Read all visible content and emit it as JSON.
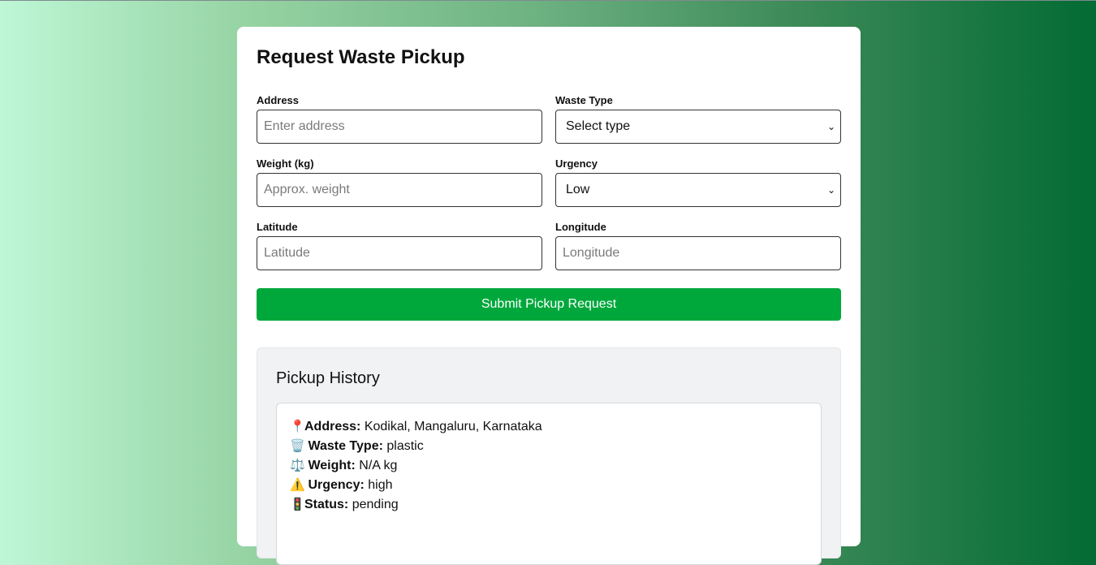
{
  "form": {
    "title": "Request Waste Pickup",
    "address": {
      "label": "Address",
      "placeholder": "Enter address"
    },
    "waste_type": {
      "label": "Waste Type",
      "value": "Select type"
    },
    "weight": {
      "label": "Weight (kg)",
      "placeholder": "Approx. weight"
    },
    "urgency": {
      "label": "Urgency",
      "value": "Low"
    },
    "latitude": {
      "label": "Latitude",
      "placeholder": "Latitude"
    },
    "longitude": {
      "label": "Longitude",
      "placeholder": "Longitude"
    },
    "submit_label": "Submit Pickup Request"
  },
  "history": {
    "title": "Pickup History",
    "entries": [
      {
        "address_label": "Address:",
        "address": "Kodikal, Mangaluru, Karnataka",
        "waste_type_label": "Waste Type:",
        "waste_type": "plastic",
        "weight_label": "Weight:",
        "weight": "N/A kg",
        "urgency_label": "Urgency:",
        "urgency": "high",
        "status_label": "Status:",
        "status": "pending"
      }
    ]
  },
  "icons": {
    "address": "pin-icon",
    "waste_type": "trash-can-icon",
    "weight": "scale-icon",
    "urgency": "warning-icon",
    "status": "traffic-light-icon",
    "select": "chevron-down-icon"
  },
  "colors": {
    "accent": "#00a83c",
    "card": "#ffffff",
    "history_bg": "#f1f2f3"
  }
}
